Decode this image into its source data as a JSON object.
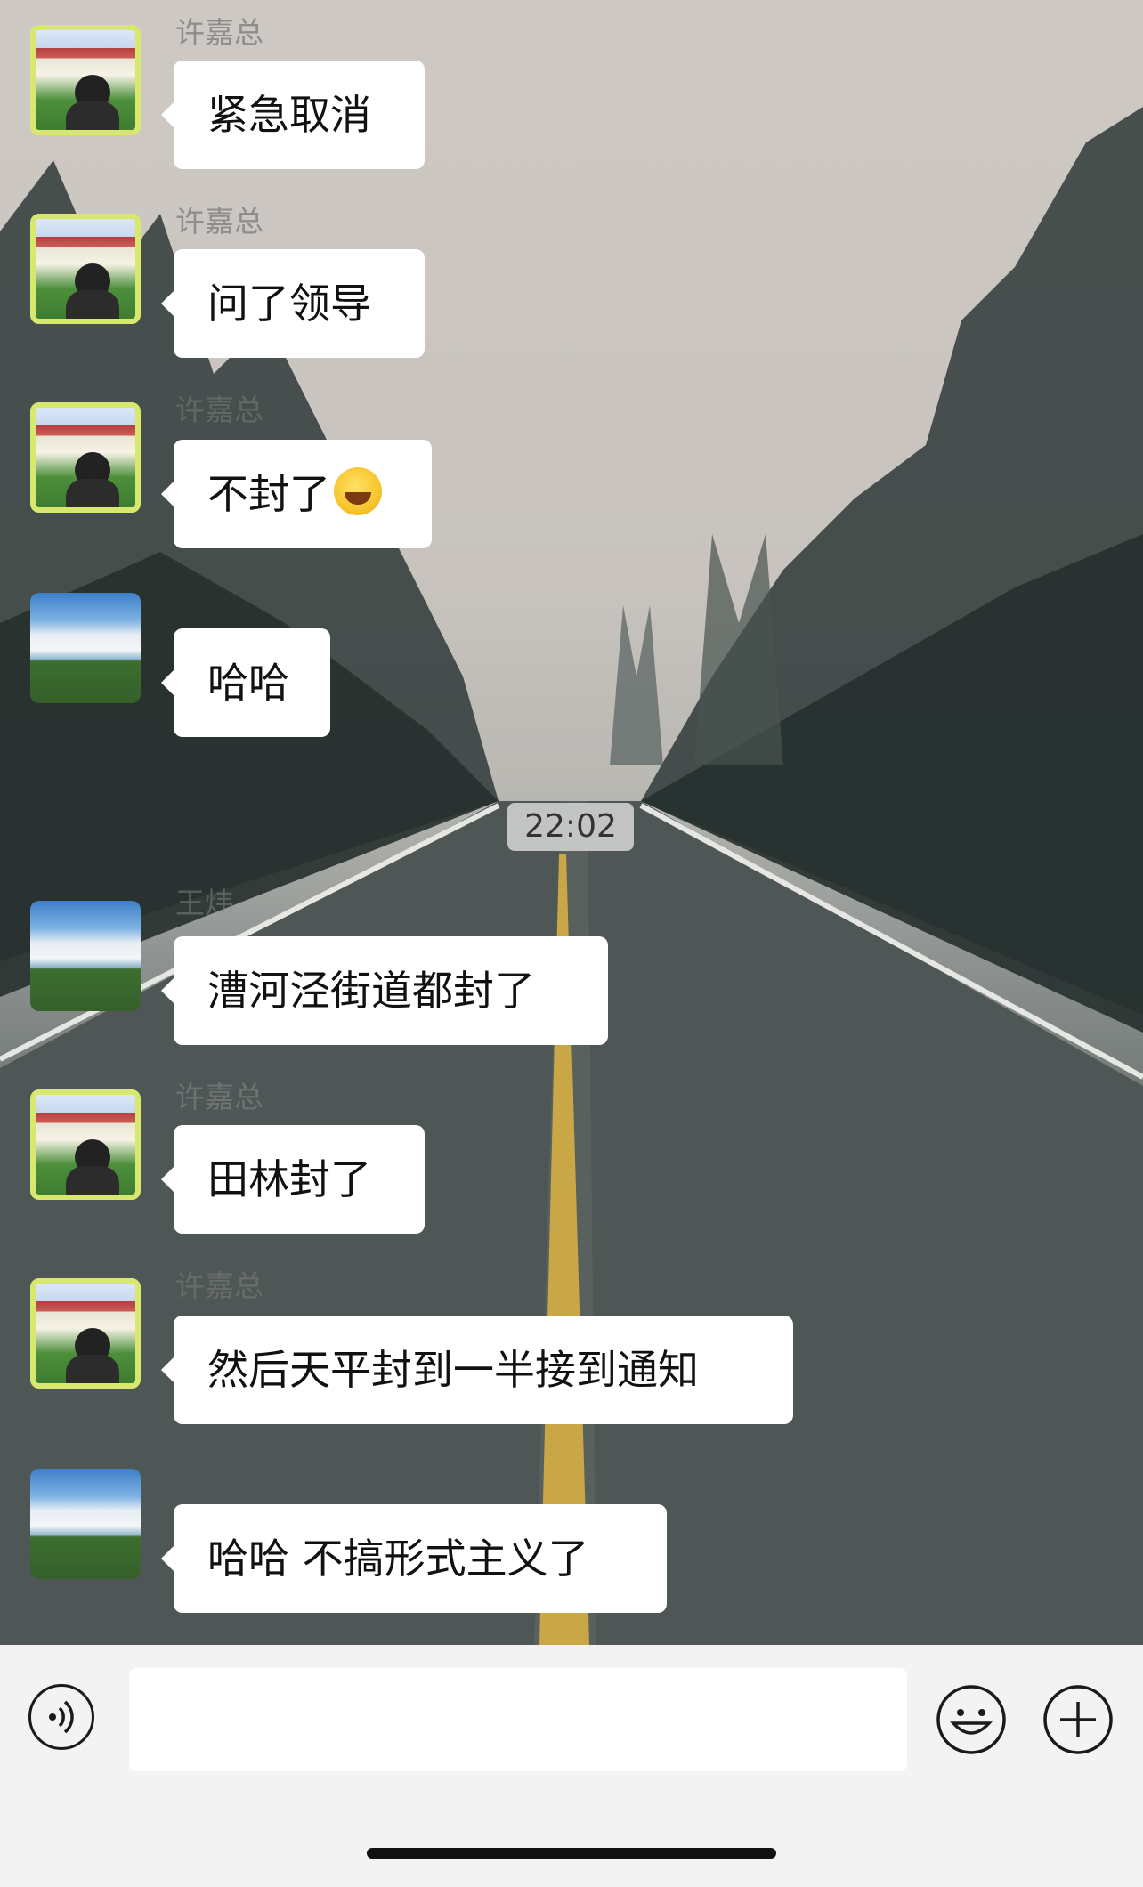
{
  "messages": [
    {
      "sender": "许嘉总",
      "text": "紧急取消",
      "avatar": "avatar-xujia"
    },
    {
      "sender": "许嘉总",
      "text": "问了领导",
      "avatar": "avatar-xujia"
    },
    {
      "sender": "许嘉总",
      "text": "不封了",
      "emoji": "laughing-crying-emoji",
      "avatar": "avatar-xujia"
    },
    {
      "sender": "",
      "text": "哈哈",
      "avatar": "avatar-landscape"
    },
    {
      "sender": "王炜",
      "text": "漕河泾街道都封了",
      "avatar": "avatar-landscape"
    },
    {
      "sender": "许嘉总",
      "text": "田林封了",
      "avatar": "avatar-xujia"
    },
    {
      "sender": "许嘉总",
      "text": "然后天平封到一半接到通知",
      "avatar": "avatar-xujia"
    },
    {
      "sender": "",
      "text": "哈哈 不搞形式主义了",
      "avatar": "avatar-landscape"
    }
  ],
  "timestamp": "22:02",
  "input_bar": {
    "voice_icon": "voice-icon",
    "emoji_icon": "smiley-icon",
    "more_icon": "plus-icon",
    "message_value": ""
  },
  "colors": {
    "bubble": "#ffffff",
    "input_bar": "#f3f3f3",
    "sender_text": "#8d8d8d"
  }
}
